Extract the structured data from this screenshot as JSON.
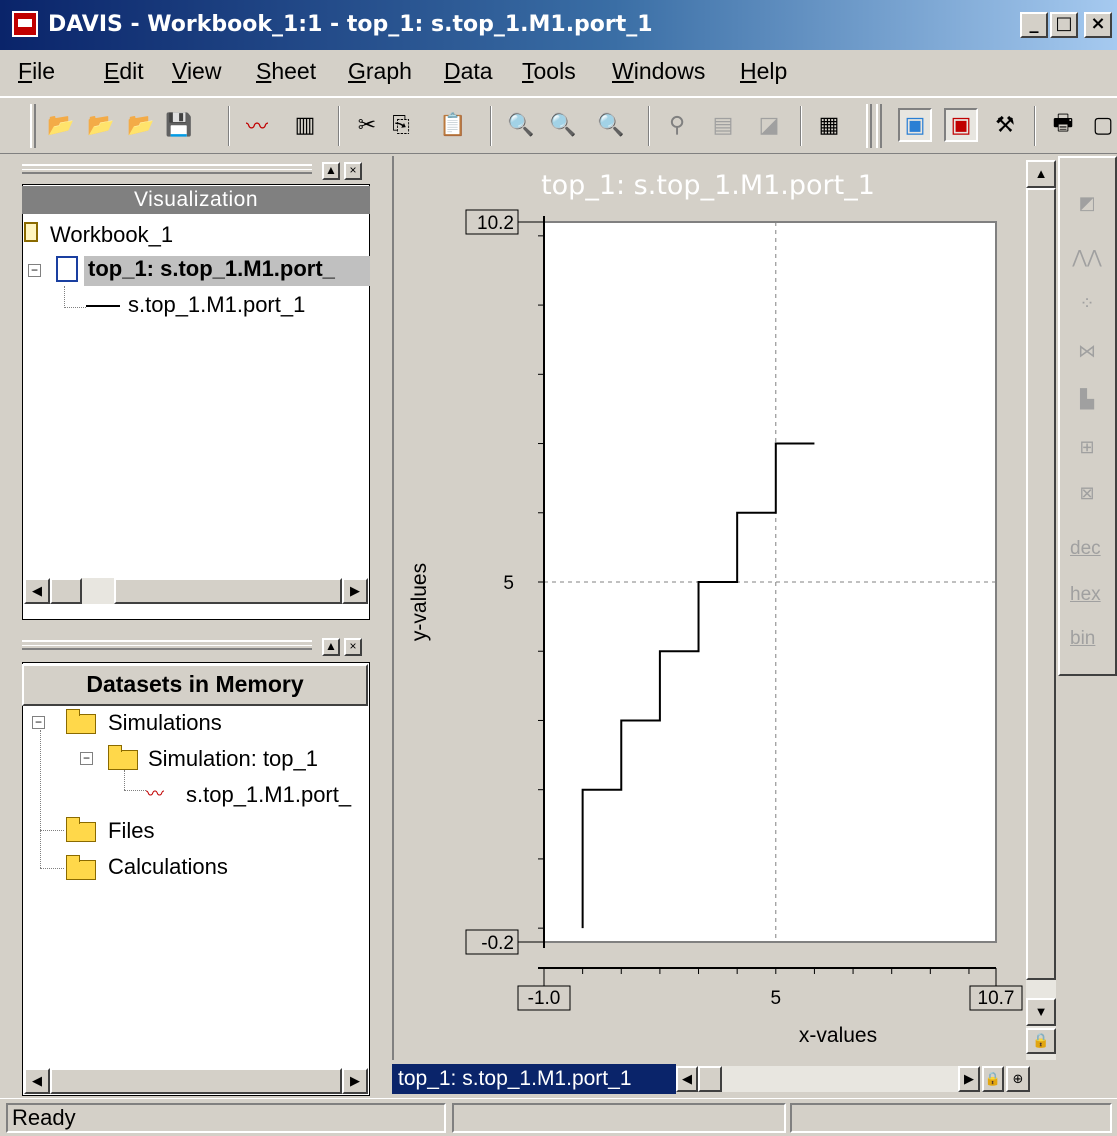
{
  "window": {
    "title": "DAVIS - Workbook_1:1 - top_1: s.top_1.M1.port_1",
    "min_label": "_",
    "max_label": "□",
    "close_label": "×"
  },
  "menu": [
    {
      "label": "File",
      "key": "F",
      "rest": "ile"
    },
    {
      "label": "Edit",
      "key": "E",
      "rest": "dit"
    },
    {
      "label": "View",
      "key": "V",
      "rest": "iew"
    },
    {
      "label": "Sheet",
      "key": "S",
      "rest": "heet"
    },
    {
      "label": "Graph",
      "key": "G",
      "rest": "raph"
    },
    {
      "label": "Data",
      "key": "D",
      "rest": "ata"
    },
    {
      "label": "Tools",
      "key": "T",
      "rest": "ools"
    },
    {
      "label": "Windows",
      "key": "W",
      "rest": "indows"
    },
    {
      "label": "Help",
      "key": "H",
      "rest": "elp"
    }
  ],
  "toolbar": {
    "open": "📂",
    "open_db": "📂",
    "import": "📂",
    "save": "💾",
    "waveform": "〰",
    "columns": "▥",
    "cut": "✂",
    "copy": "⎘",
    "paste": "📋",
    "zoom_out": "🔍",
    "zoom_in": "🔍",
    "zoom_fit": "🔍",
    "cursor": "⚲",
    "table": "▤",
    "eraser": "◪",
    "calculator": "▦",
    "mode1": "▣",
    "mode2": "▣",
    "mode3": "⚒",
    "print": "🖶",
    "preview": "▢"
  },
  "visualization": {
    "header": "Visualization",
    "workbook": "Workbook_1",
    "graph_node": "top_1: s.top_1.M1.port_",
    "signal_node": "s.top_1.M1.port_1"
  },
  "datasets": {
    "header": "Datasets in Memory",
    "simulations": "Simulations",
    "simulation": "Simulation: top_1",
    "signal": "s.top_1.M1.port_",
    "files": "Files",
    "calculations": "Calculations"
  },
  "graph": {
    "tab_label": "top_1: s.top_1.M1.port_1"
  },
  "chart_data": {
    "type": "line",
    "step": true,
    "title": "top_1: s.top_1.M1.port_1",
    "xlabel": "x-values",
    "ylabel": "y-values",
    "xlim": [
      -1.0,
      10.7
    ],
    "ylim": [
      -0.2,
      10.2
    ],
    "x_tick_labels": [
      "-1.0",
      "5",
      "10.7"
    ],
    "y_tick_labels": [
      "10.2",
      "5",
      "-0.2"
    ],
    "grid": true,
    "series": [
      {
        "x": [
          0,
          0,
          1,
          1,
          2,
          2,
          3,
          3,
          4,
          4,
          5,
          5,
          6
        ],
        "y": [
          0,
          2,
          2,
          3,
          3,
          4,
          4,
          5,
          5,
          6,
          6,
          7,
          7
        ]
      }
    ]
  },
  "tool_strip": {
    "dec": "dec",
    "hex": "hex",
    "bin": "bin"
  },
  "status": {
    "text": "Ready"
  }
}
